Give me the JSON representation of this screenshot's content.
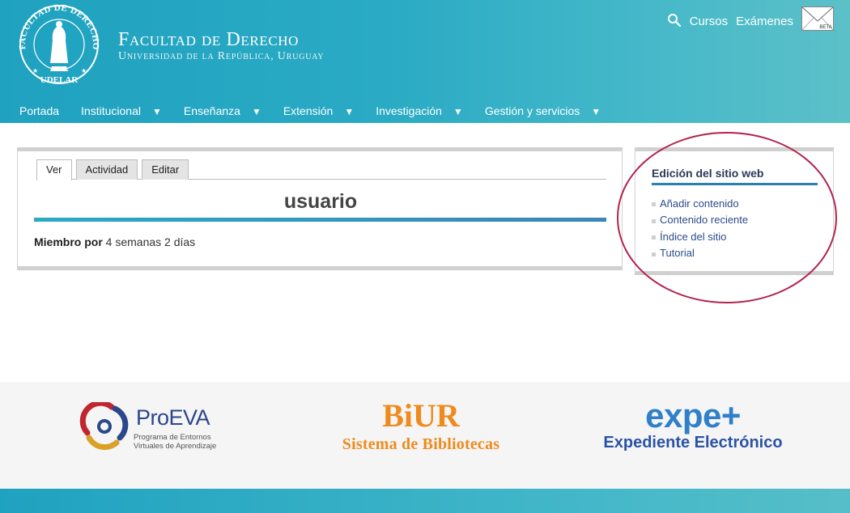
{
  "header": {
    "title": "Facultad de Derecho",
    "subtitle": "Universidad de la República, Uruguay",
    "seal_text_top": "FACULTAD DE DERECHO",
    "seal_text_bottom": "UDELAR",
    "top_links": [
      "Cursos",
      "Exámenes"
    ],
    "mail_badge": "BETA",
    "icons": {
      "search": "search-icon",
      "mail": "mail-beta-icon"
    }
  },
  "nav": {
    "items": [
      {
        "label": "Portada",
        "has_dropdown": false
      },
      {
        "label": "Institucional",
        "has_dropdown": true
      },
      {
        "label": "Enseñanza",
        "has_dropdown": true
      },
      {
        "label": "Extensión",
        "has_dropdown": true
      },
      {
        "label": "Investigación",
        "has_dropdown": true
      },
      {
        "label": "Gestión y servicios",
        "has_dropdown": true
      }
    ],
    "dropdown_glyph": "▼"
  },
  "main": {
    "tabs": [
      {
        "label": "Ver",
        "active": true
      },
      {
        "label": "Actividad",
        "active": false
      },
      {
        "label": "Editar",
        "active": false
      }
    ],
    "page_title": "usuario",
    "member_label": "Miembro por",
    "member_value": "4 semanas 2 días"
  },
  "sidebar": {
    "title": "Edición del sitio web",
    "links": [
      "Añadir contenido",
      "Contenido reciente",
      "Índice del sitio",
      "Tutorial"
    ]
  },
  "partners": {
    "proeva": {
      "name_pre": "Pro",
      "name_post": "EVA",
      "subtitle_line1": "Programa de Entornos",
      "subtitle_line2": "Virtuales de Aprendizaje"
    },
    "biur": {
      "name": "BiUR",
      "subtitle": "Sistema de Bibliotecas"
    },
    "expe": {
      "name": "expe+",
      "subtitle": "Expediente Electrónico"
    }
  },
  "colors": {
    "header_teal": "#2aaac4",
    "annotation_circle": "#b3244d",
    "link_blue": "#2b4c8a",
    "biur_orange": "#ef8a1d",
    "expe_blue": "#2f80c9"
  }
}
